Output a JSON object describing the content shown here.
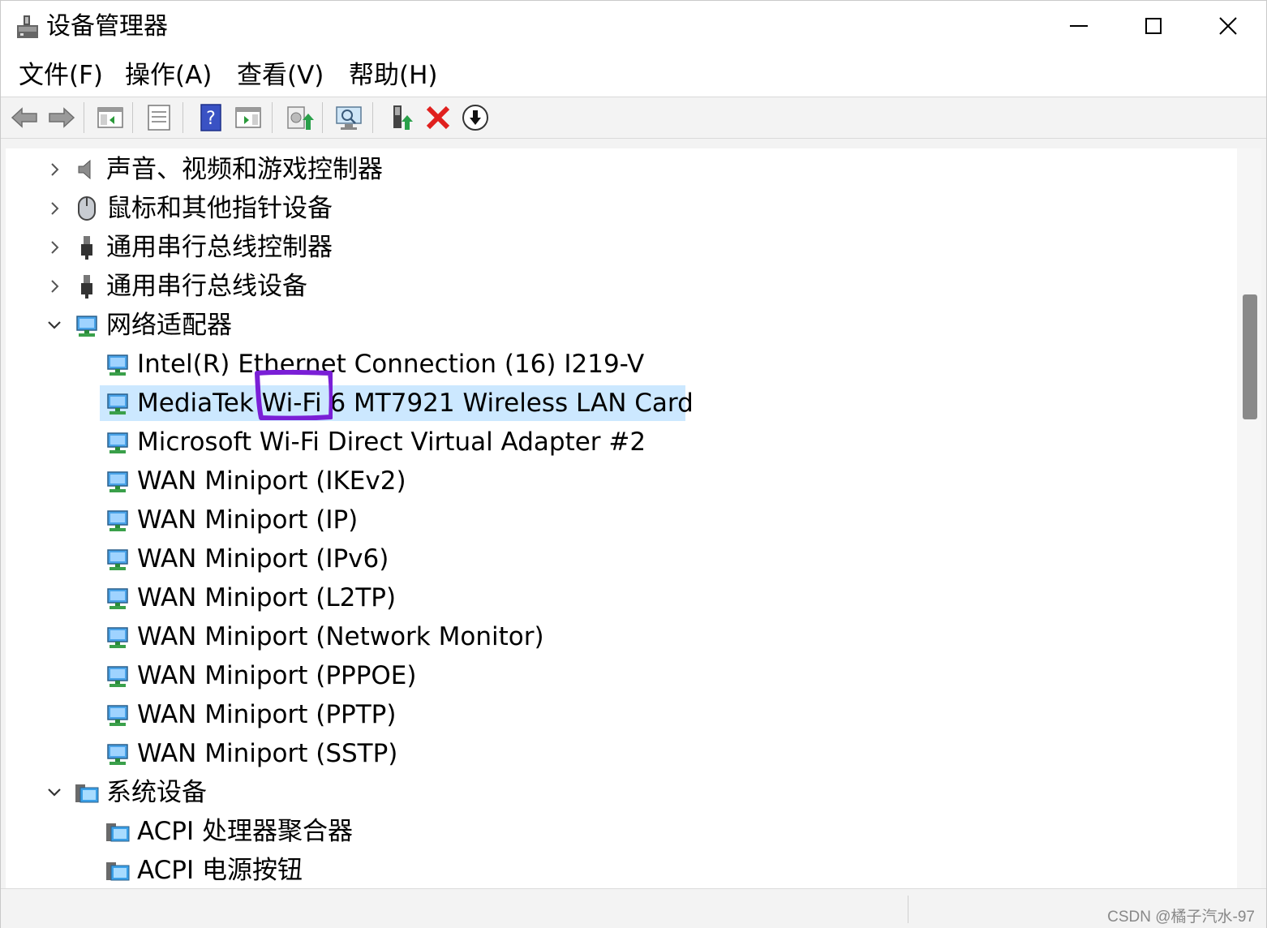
{
  "window": {
    "title": "设备管理器",
    "buttons": {
      "minimize": "minimize-icon",
      "maximize": "maximize-icon",
      "close": "close-icon"
    }
  },
  "menu": {
    "file": "文件(F)",
    "action": "操作(A)",
    "view": "查看(V)",
    "help": "帮助(H)"
  },
  "toolbar": {
    "icons": [
      "back-arrow-icon",
      "forward-arrow-icon",
      "show-hide-console-tree-icon",
      "properties-icon",
      "help-icon",
      "action-pane-icon",
      "update-driver-icon",
      "scan-hardware-icon",
      "enable-device-icon",
      "uninstall-device-icon",
      "disable-device-icon"
    ]
  },
  "tree": {
    "categories": {
      "sound": "声音、视频和游戏控制器",
      "mice": "鼠标和其他指针设备",
      "usb_controllers": "通用串行总线控制器",
      "usb_devices": "通用串行总线设备",
      "network": "网络适配器",
      "system": "系统设备"
    },
    "network_devices": [
      "Intel(R) Ethernet Connection (16) I219-V",
      "MediaTek Wi-Fi 6 MT7921 Wireless LAN Card",
      "Microsoft Wi-Fi Direct Virtual Adapter #2",
      "WAN Miniport (IKEv2)",
      "WAN Miniport (IP)",
      "WAN Miniport (IPv6)",
      "WAN Miniport (L2TP)",
      "WAN Miniport (Network Monitor)",
      "WAN Miniport (PPPOE)",
      "WAN Miniport (PPTP)",
      "WAN Miniport (SSTP)"
    ],
    "system_devices": [
      "ACPI 处理器聚合器",
      "ACPI 电源按钮"
    ],
    "selected": "MediaTek Wi-Fi 6 MT7921 Wireless LAN Card"
  },
  "colors": {
    "selection": "#cce8ff",
    "annotation": "#7a1fd6",
    "window_bg": "#f3f3f3"
  },
  "watermark": "CSDN @橘子汽水-97"
}
